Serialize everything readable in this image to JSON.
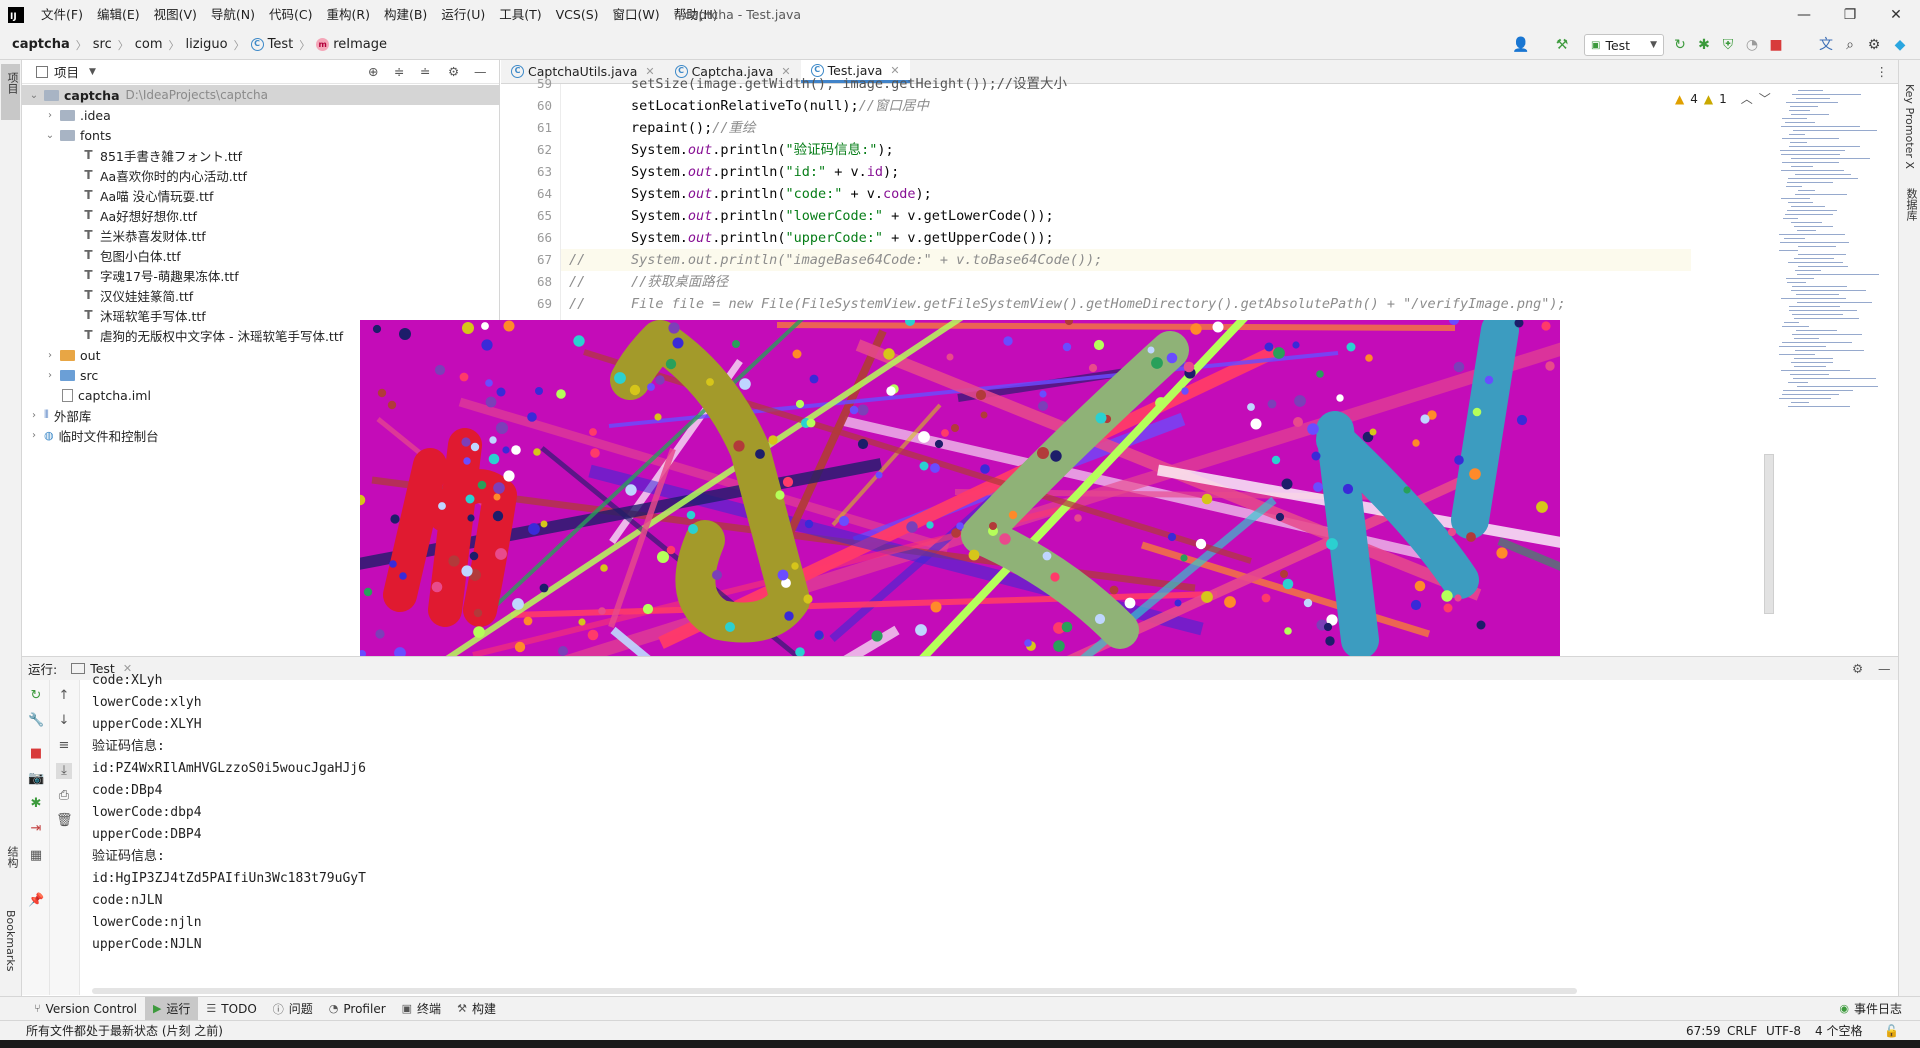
{
  "window": {
    "title": "captcha - Test.java",
    "menu": [
      "文件(F)",
      "编辑(E)",
      "视图(V)",
      "导航(N)",
      "代码(C)",
      "重构(R)",
      "构建(B)",
      "运行(U)",
      "工具(T)",
      "VCS(S)",
      "窗口(W)",
      "帮助(H)"
    ]
  },
  "navbar": {
    "crumbs": [
      "captcha",
      "src",
      "com",
      "liziguo",
      "Test",
      "reImage"
    ],
    "run_config": "Test"
  },
  "left_stripe": {
    "project_label": "项目",
    "structure_label": "结构",
    "bookmarks_label": "Bookmarks"
  },
  "right_stripe": {
    "key_promoter": "Key Promoter X",
    "database": "数据库"
  },
  "project": {
    "header": "项目",
    "root_name": "captcha",
    "root_path": "D:\\IdeaProjects\\captcha",
    "idea": ".idea",
    "fonts": "fonts",
    "font_files": [
      "851手書き雑フォント.ttf",
      "Aa喜欢你时的内心活动.ttf",
      "Aa喵 没心情玩耍.ttf",
      "Aa好想好想你.ttf",
      "兰米恭喜发财体.ttf",
      "包图小白体.ttf",
      "字魂17号-萌趣果冻体.ttf",
      "汉仪娃娃篆简.ttf",
      "沐瑶软笔手写体.ttf",
      "虐狗的无版权中文字体 - 沐瑶软笔手写体.ttf"
    ],
    "out": "out",
    "src": "src",
    "iml": "captcha.iml",
    "external_libs": "外部库",
    "scratches": "临时文件和控制台"
  },
  "editor": {
    "tabs": [
      "CaptchaUtils.java",
      "Captcha.java",
      "Test.java"
    ],
    "active_tab": "Test.java",
    "warnings": "4",
    "weak_warnings": "1",
    "line_numbers": [
      "60",
      "61",
      "62",
      "63",
      "64",
      "65",
      "66",
      "67",
      "68",
      "69"
    ],
    "line_top_partial": "setSize(image.getWidth(), image.getHeight());//设置大小",
    "line60": {
      "code": "setLocationRelativeTo(null);",
      "comment": "//窗口居中"
    },
    "line61": {
      "code": "repaint();",
      "comment": "//重绘"
    },
    "line62": {
      "pre": "System.",
      "field": "out",
      "mid": ".println(",
      "str": "\"验证码信息:\"",
      "post": ");"
    },
    "line63": {
      "pre": "System.",
      "field": "out",
      "mid": ".println(",
      "str": "\"id:\"",
      "post": " + v.",
      "prop": "id",
      "end": ");"
    },
    "line64": {
      "pre": "System.",
      "field": "out",
      "mid": ".println(",
      "str": "\"code:\"",
      "post": " + v.",
      "prop": "code",
      "end": ");"
    },
    "line65": {
      "pre": "System.",
      "field": "out",
      "mid": ".println(",
      "str": "\"lowerCode:\"",
      "post": " + v.getLowerCode());"
    },
    "line66": {
      "pre": "System.",
      "field": "out",
      "mid": ".println(",
      "str": "\"upperCode:\"",
      "post": " + v.getUpperCode());"
    },
    "line67": "System.out.println(\"imageBase64Code:\" + v.toBase64Code());",
    "line68": "//获取桌面路径",
    "line69": "File file = new File(FileSystemView.getFileSystemView().getHomeDirectory().getAbsolutePath() + \"/verifyImage.png\");",
    "comment_prefix": "//"
  },
  "run": {
    "label": "运行:",
    "tab": "Test",
    "console": [
      "code:XLyh",
      "lowerCode:xlyh",
      "upperCode:XLYH",
      "验证码信息:",
      "id:PZ4WxRIlAmHVGLzzoS0i5woucJgaHJj6",
      "code:DBp4",
      "lowerCode:dbp4",
      "upperCode:DBP4",
      "验证码信息:",
      "id:HgIP3ZJ4tZd5PAIfiUn3Wc183t79uGyT",
      "code:nJLN",
      "lowerCode:njln",
      "upperCode:NJLN"
    ]
  },
  "captcha_image": {
    "background": "#c40cb8",
    "letters": [
      "n",
      "J",
      "L",
      "N"
    ]
  },
  "toolwindows": [
    "Version Control",
    "运行",
    "TODO",
    "问题",
    "Profiler",
    "终端",
    "构建"
  ],
  "event_log": "事件日志",
  "status": {
    "message": "所有文件都处于最新状态 (片刻 之前)",
    "position": "67:59",
    "line_sep": "CRLF",
    "encoding": "UTF-8",
    "indent": "4 个空格"
  }
}
